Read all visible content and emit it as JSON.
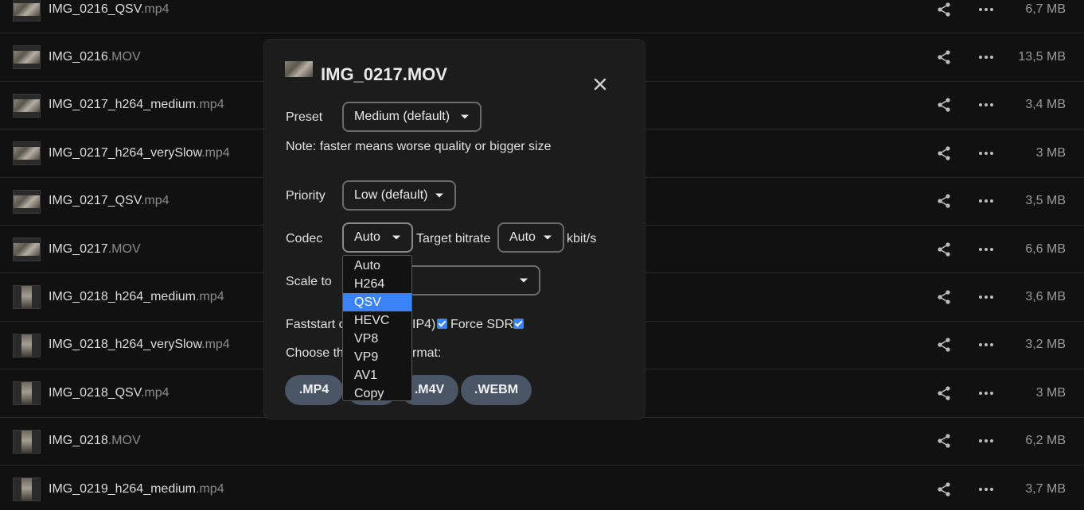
{
  "files": [
    {
      "base": "IMG_0216_QSV",
      "ext": ".mp4",
      "size": "6,7 MB",
      "portrait": false
    },
    {
      "base": "IMG_0216",
      "ext": ".MOV",
      "size": "13,5 MB",
      "portrait": false
    },
    {
      "base": "IMG_0217_h264_medium",
      "ext": ".mp4",
      "size": "3,4 MB",
      "portrait": false
    },
    {
      "base": "IMG_0217_h264_verySlow",
      "ext": ".mp4",
      "size": "3 MB",
      "portrait": false
    },
    {
      "base": "IMG_0217_QSV",
      "ext": ".mp4",
      "size": "3,5 MB",
      "portrait": false
    },
    {
      "base": "IMG_0217",
      "ext": ".MOV",
      "size": "6,6 MB",
      "portrait": false
    },
    {
      "base": "IMG_0218_h264_medium",
      "ext": ".mp4",
      "size": "3,6 MB",
      "portrait": true
    },
    {
      "base": "IMG_0218_h264_verySlow",
      "ext": ".mp4",
      "size": "3,2 MB",
      "portrait": true
    },
    {
      "base": "IMG_0218_QSV",
      "ext": ".mp4",
      "size": "3 MB",
      "portrait": true
    },
    {
      "base": "IMG_0218",
      "ext": ".MOV",
      "size": "6,2 MB",
      "portrait": true
    },
    {
      "base": "IMG_0219_h264_medium",
      "ext": ".mp4",
      "size": "3,7 MB",
      "portrait": true
    }
  ],
  "modal": {
    "title": "IMG_0217.MOV",
    "preset_label": "Preset",
    "preset_value": "Medium (default)",
    "note": "Note: faster means worse quality or bigger size",
    "priority_label": "Priority",
    "priority_value": "Low (default)",
    "codec_label": "Codec",
    "codec_value": "Auto",
    "bitrate_label": "Target bitrate",
    "bitrate_value": "Auto",
    "bitrate_unit": "kbit/s",
    "scale_label": "Scale to",
    "scale_value": "",
    "faststart_left": "Faststart o",
    "faststart_right": "IP4)",
    "force_sdr_label": "Force SDR",
    "choose_left": "Choose th",
    "choose_right": "rmat:",
    "formats": [
      ".MP4",
      "",
      ".M4V",
      ".WEBM"
    ]
  },
  "codec_dropdown": {
    "options": [
      "Auto",
      "H264",
      "QSV",
      "HEVC",
      "VP8",
      "VP9",
      "AV1",
      "Copy"
    ],
    "highlighted": "QSV"
  },
  "colors": {
    "accent": "#3b82f6",
    "format_button": "#4a5566",
    "background": "#111111",
    "modal": "#1c1c1d"
  }
}
